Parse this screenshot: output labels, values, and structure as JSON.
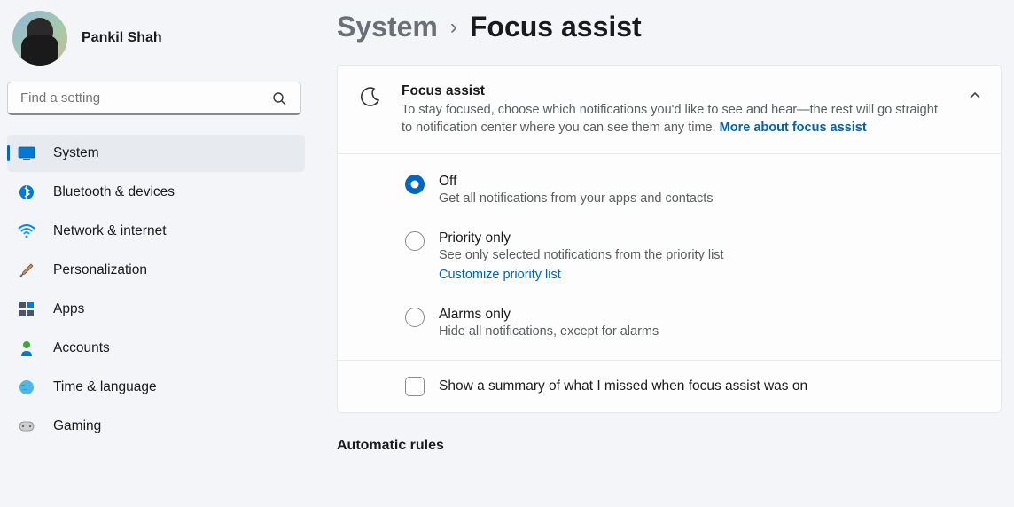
{
  "user": {
    "name": "Pankil Shah"
  },
  "search": {
    "placeholder": "Find a setting"
  },
  "nav": {
    "items": [
      {
        "label": "System",
        "icon": "system"
      },
      {
        "label": "Bluetooth & devices",
        "icon": "bluetooth"
      },
      {
        "label": "Network & internet",
        "icon": "wifi"
      },
      {
        "label": "Personalization",
        "icon": "brush"
      },
      {
        "label": "Apps",
        "icon": "apps"
      },
      {
        "label": "Accounts",
        "icon": "person"
      },
      {
        "label": "Time & language",
        "icon": "globe"
      },
      {
        "label": "Gaming",
        "icon": "gamepad"
      }
    ],
    "selected_index": 0
  },
  "breadcrumb": {
    "parent": "System",
    "sep": "›",
    "current": "Focus assist"
  },
  "focus": {
    "title": "Focus assist",
    "desc_a": "To stay focused, choose which notifications you'd like to see and hear—the rest will go straight to notification center where you can see them any time.  ",
    "more_link": "More about focus assist",
    "options": [
      {
        "label": "Off",
        "sub": "Get all notifications from your apps and contacts"
      },
      {
        "label": "Priority only",
        "sub": "See only selected notifications from the priority list",
        "link": "Customize priority list"
      },
      {
        "label": "Alarms only",
        "sub": "Hide all notifications, except for alarms"
      }
    ],
    "selected_option": 0,
    "summary_label": "Show a summary of what I missed when focus assist was on"
  },
  "section": {
    "automatic_rules": "Automatic rules"
  }
}
